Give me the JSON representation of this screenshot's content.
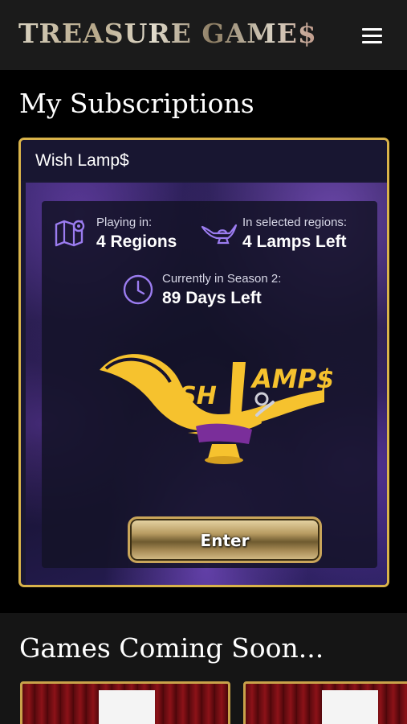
{
  "header": {
    "brand": "TREASURE GAME$",
    "menu_icon": "hamburger-menu-icon"
  },
  "subscriptions": {
    "title": "My Subscriptions",
    "card": {
      "title": "Wish Lamp$",
      "stats": {
        "regions_label": "Playing in:",
        "regions_value": "4 Regions",
        "lamps_label": "In selected regions:",
        "lamps_value": "4 Lamps Left",
        "season_label": "Currently in Season 2:",
        "season_value": "89 Days Left"
      },
      "icons": {
        "regions": "map-pin-icon",
        "lamps": "genie-lamp-icon",
        "season": "clock-icon"
      },
      "logo_text": "WISH LAMP$",
      "enter_label": "Enter"
    }
  },
  "coming_soon": {
    "title": "Games Coming Soon..."
  },
  "colors": {
    "accent_gold": "#d9b34a",
    "logo_yellow": "#f6c22e",
    "icon_purple": "#9b7cf0",
    "card_bg": "#1a1833"
  }
}
